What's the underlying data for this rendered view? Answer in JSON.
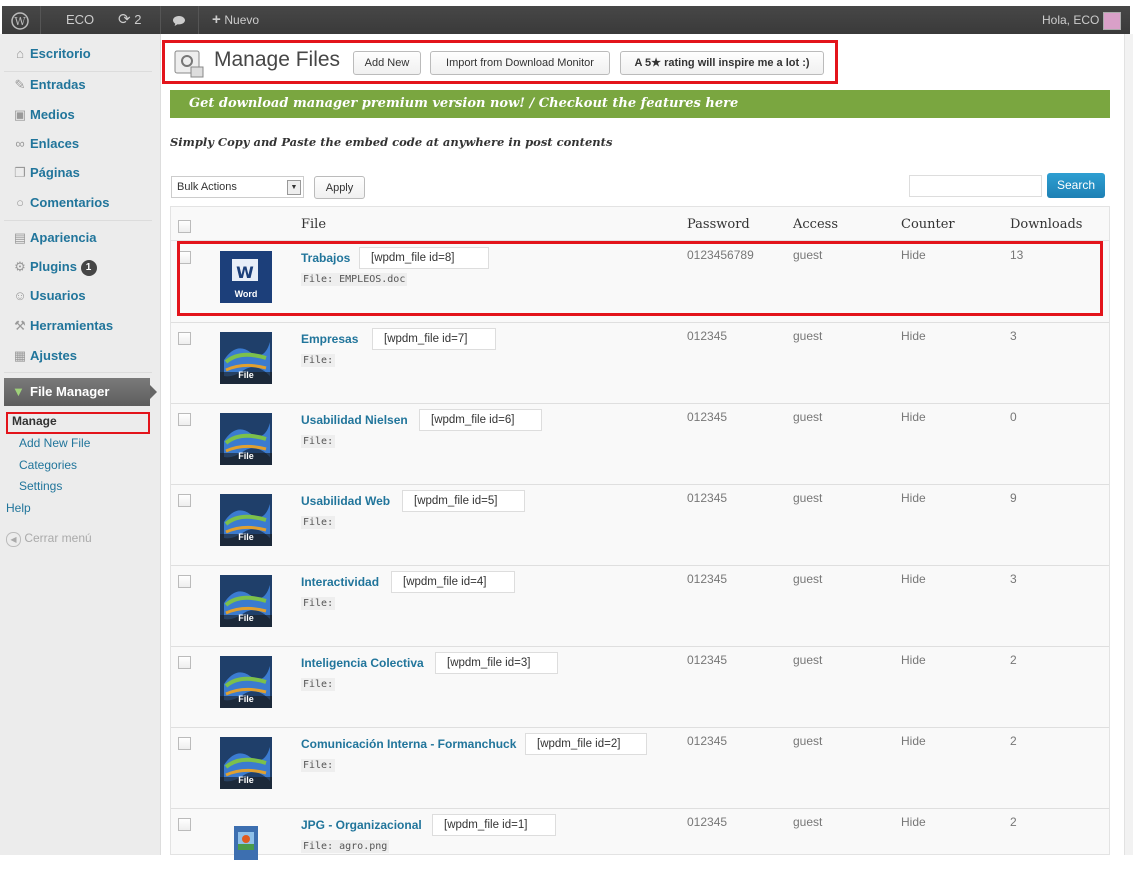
{
  "adminbar": {
    "site_name": "ECO",
    "updates_count": "2",
    "new_label": "Nuevo",
    "greeting": "Hola, ECO"
  },
  "sidebar": {
    "items": [
      {
        "label": "Escritorio",
        "icon": "home-icon"
      },
      {
        "label": "Entradas",
        "icon": "pin-icon"
      },
      {
        "label": "Medios",
        "icon": "media-icon"
      },
      {
        "label": "Enlaces",
        "icon": "link-icon"
      },
      {
        "label": "Páginas",
        "icon": "pages-icon"
      },
      {
        "label": "Comentarios",
        "icon": "comment-icon"
      },
      {
        "label": "Apariencia",
        "icon": "appearance-icon"
      },
      {
        "label": "Plugins",
        "icon": "plugins-icon",
        "badge": "1"
      },
      {
        "label": "Usuarios",
        "icon": "users-icon"
      },
      {
        "label": "Herramientas",
        "icon": "tools-icon"
      },
      {
        "label": "Ajustes",
        "icon": "settings-icon"
      }
    ],
    "file_manager": {
      "label": "File Manager",
      "submenu": [
        "Manage",
        "Add New File",
        "Categories",
        "Settings",
        "Help"
      ]
    },
    "collapse_label": "Cerrar menú"
  },
  "header": {
    "title": "Manage Files",
    "add_new": "Add New",
    "import": "Import from Download Monitor",
    "rating": "A 5★ rating will inspire me a lot :)"
  },
  "promo": "Get download manager premium version now! / Checkout the features here",
  "hint": "Simply Copy and Paste the embed code at anywhere in post contents",
  "toolbar": {
    "bulk_actions": "Bulk Actions",
    "apply": "Apply",
    "search": "Search"
  },
  "table": {
    "columns": [
      "File",
      "Password",
      "Access",
      "Counter",
      "Downloads"
    ],
    "rows": [
      {
        "name": "Trabajos",
        "code": "[wpdm_file id=8]",
        "file": "File: EMPLEOS.doc",
        "password": "0123456789",
        "access": "guest",
        "counter": "Hide",
        "downloads": "13",
        "thumb": "word-icon",
        "thumb_label": "Word"
      },
      {
        "name": "Empresas",
        "code": "[wpdm_file id=7]",
        "file": "File:",
        "password": "012345",
        "access": "guest",
        "counter": "Hide",
        "downloads": "3",
        "thumb": "file-icon",
        "thumb_label": "File"
      },
      {
        "name": "Usabilidad Nielsen",
        "code": "[wpdm_file id=6]",
        "file": "File:",
        "password": "012345",
        "access": "guest",
        "counter": "Hide",
        "downloads": "0",
        "thumb": "file-icon",
        "thumb_label": "File"
      },
      {
        "name": "Usabilidad Web",
        "code": "[wpdm_file id=5]",
        "file": "File:",
        "password": "012345",
        "access": "guest",
        "counter": "Hide",
        "downloads": "9",
        "thumb": "file-icon",
        "thumb_label": "File"
      },
      {
        "name": "Interactividad",
        "code": "[wpdm_file id=4]",
        "file": "File:",
        "password": "012345",
        "access": "guest",
        "counter": "Hide",
        "downloads": "3",
        "thumb": "file-icon",
        "thumb_label": "File"
      },
      {
        "name": "Inteligencia Colectiva",
        "code": "[wpdm_file id=3]",
        "file": "File:",
        "password": "012345",
        "access": "guest",
        "counter": "Hide",
        "downloads": "2",
        "thumb": "file-icon",
        "thumb_label": "File"
      },
      {
        "name": "Comunicación Interna - Formanchuck",
        "code": "[wpdm_file id=2]",
        "file": "File:",
        "password": "012345",
        "access": "guest",
        "counter": "Hide",
        "downloads": "2",
        "thumb": "file-icon",
        "thumb_label": "File"
      },
      {
        "name": "JPG - Organizacional",
        "code": "[wpdm_file id=1]",
        "file": "File: agro.png",
        "password": "012345",
        "access": "guest",
        "counter": "Hide",
        "downloads": "2",
        "thumb": "image-icon",
        "thumb_label": ""
      }
    ]
  },
  "colors": {
    "accent": "#21759b",
    "promo": "#7aa640",
    "highlight": "#e3141b",
    "search": "#2389c2"
  }
}
